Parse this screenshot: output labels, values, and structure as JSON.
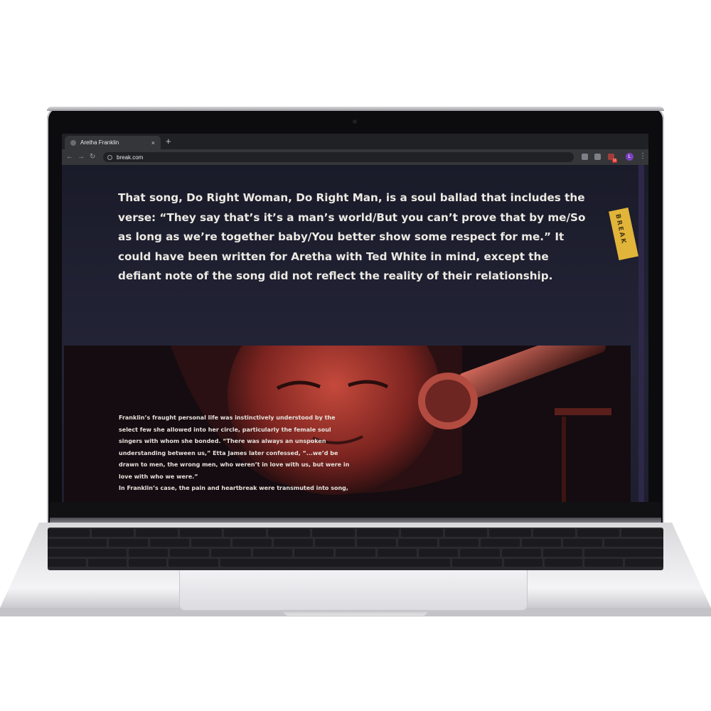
{
  "browser": {
    "tab_title": "Aretha Franklin",
    "tab_close": "×",
    "new_tab": "+",
    "back": "←",
    "forward": "→",
    "reload": "↻",
    "url": "break.com",
    "badge": "11",
    "avatar_letter": "L",
    "menu": "⋮"
  },
  "page": {
    "quote": "That song, Do Right Woman, Do Right Man, is a soul ballad that includes the verse: “They say that’s it’s a man’s world/But you can’t prove that by me/So as long as we’re together baby/You better show some respect for me.” It could have been written for Aretha with Ted White in mind, except the defiant note of the song did not reflect the reality of their relationship.",
    "brand_tag": "BREAK",
    "paragraph_1": "Franklin’s fraught personal life was instinctively understood by the select few she allowed into her circle, particularly the female soul singers with whom she bonded. “There was always an unspoken understanding between us,” Etta James later confessed, “...we’d be drawn to men, the wrong men, who weren’t in love with us, but were in love with who we were.”",
    "paragraph_2": "In Franklin’s case, the pain and heartbreak were transmuted into song,"
  },
  "colors": {
    "page_bg": "#1c1c28",
    "accent_tag": "#e1b43a",
    "photo_tint": "#c0392b"
  }
}
